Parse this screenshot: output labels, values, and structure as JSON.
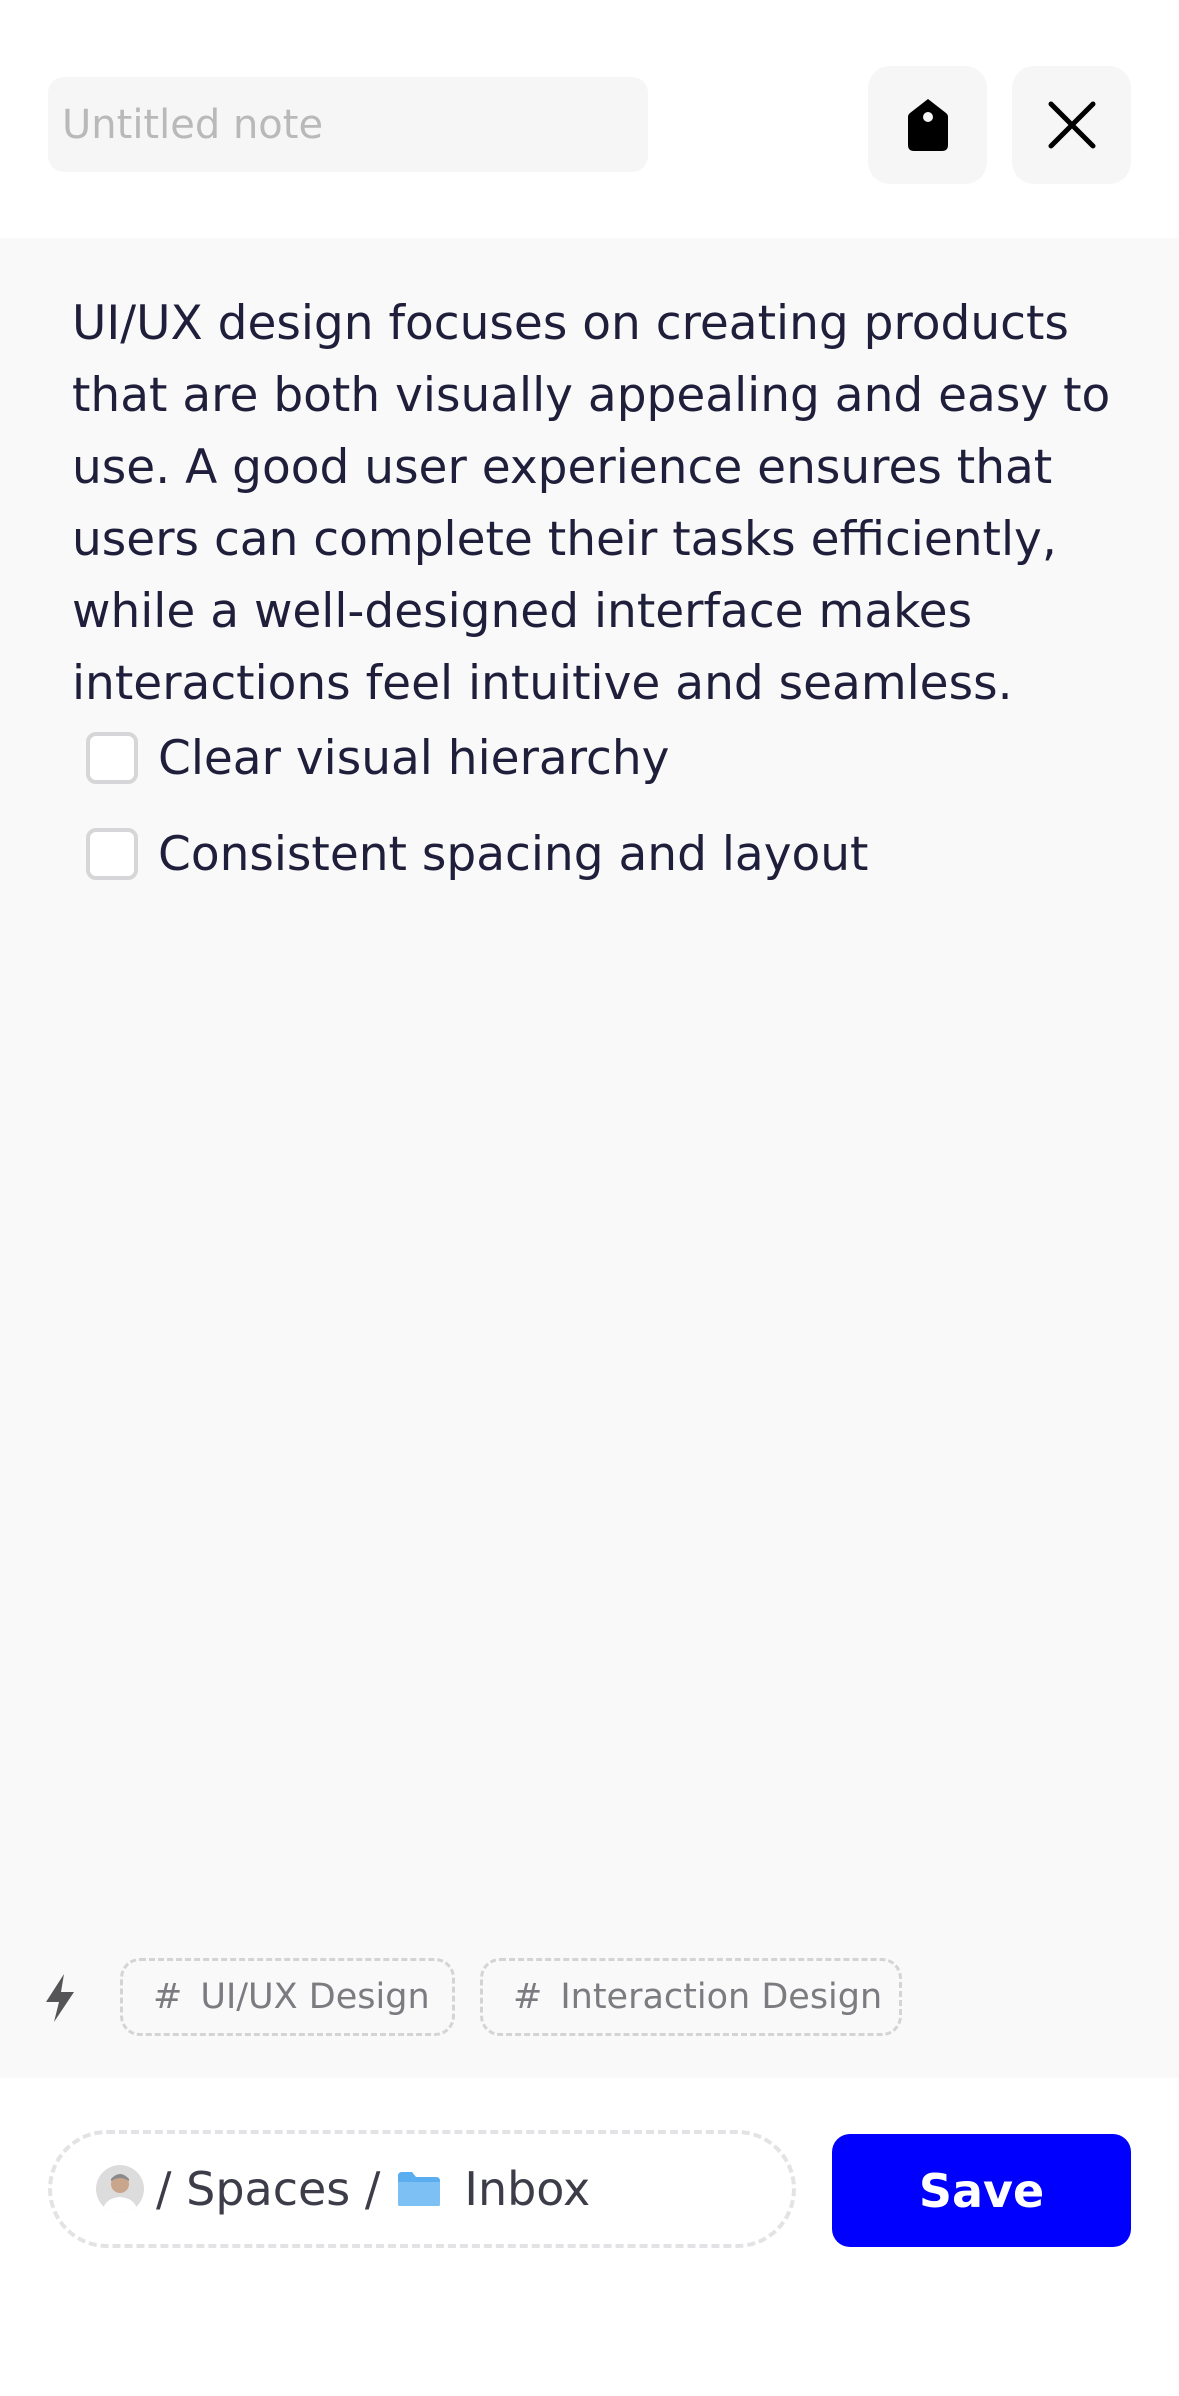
{
  "header": {
    "title_value": "",
    "title_placeholder": "Untitled note",
    "tag_icon": "tag-icon",
    "close_icon": "close-icon"
  },
  "note": {
    "body": "UI/UX design focuses on creating products that are both visually appealing and easy to use. A good user experience ensures that users can complete their tasks efficiently, while a well-designed interface makes interactions feel intuitive and seamless.",
    "checklist": [
      {
        "label": "Clear visual hierarchy",
        "checked": false
      },
      {
        "label": "Consistent spacing and layout",
        "checked": false
      }
    ]
  },
  "tags": {
    "bolt_icon": "bolt-icon",
    "items": [
      {
        "hash": "#",
        "label": "UI/UX Design"
      },
      {
        "hash": "#",
        "label": "Interaction Design"
      }
    ]
  },
  "footer": {
    "path_sep_1": "/ Spaces /",
    "folder_icon": "folder-icon",
    "folder_label": "Inbox",
    "save_label": "Save"
  },
  "colors": {
    "accent": "#0000ff",
    "text": "#1f1f3b",
    "editor_bg": "#f9f9fa",
    "folder": "#5aaef0"
  }
}
